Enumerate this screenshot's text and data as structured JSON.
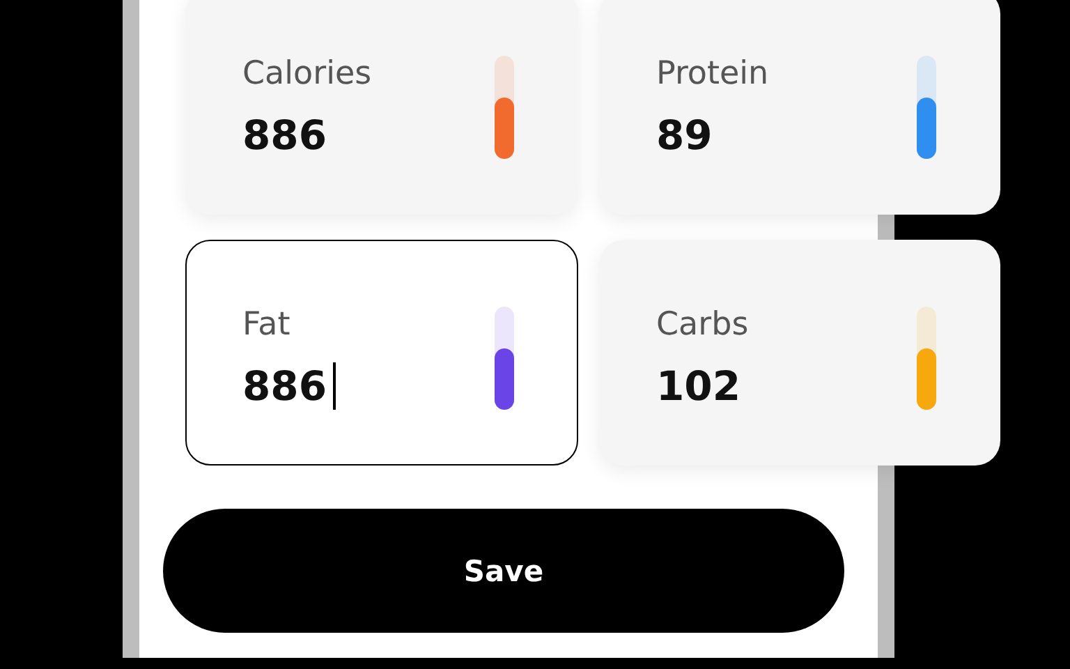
{
  "nutrients": [
    {
      "label": "Calories",
      "value": "886",
      "level": 0.6,
      "color": "#f26b2e",
      "focused": false
    },
    {
      "label": "Protein",
      "value": "89",
      "level": 0.6,
      "color": "#2f8ff0",
      "focused": false
    },
    {
      "label": "Fat",
      "value": "886",
      "level": 0.6,
      "color": "#6a44e6",
      "focused": true
    },
    {
      "label": "Carbs",
      "value": "102",
      "level": 0.6,
      "color": "#f7a80c",
      "focused": false
    }
  ],
  "save_button": "Save"
}
